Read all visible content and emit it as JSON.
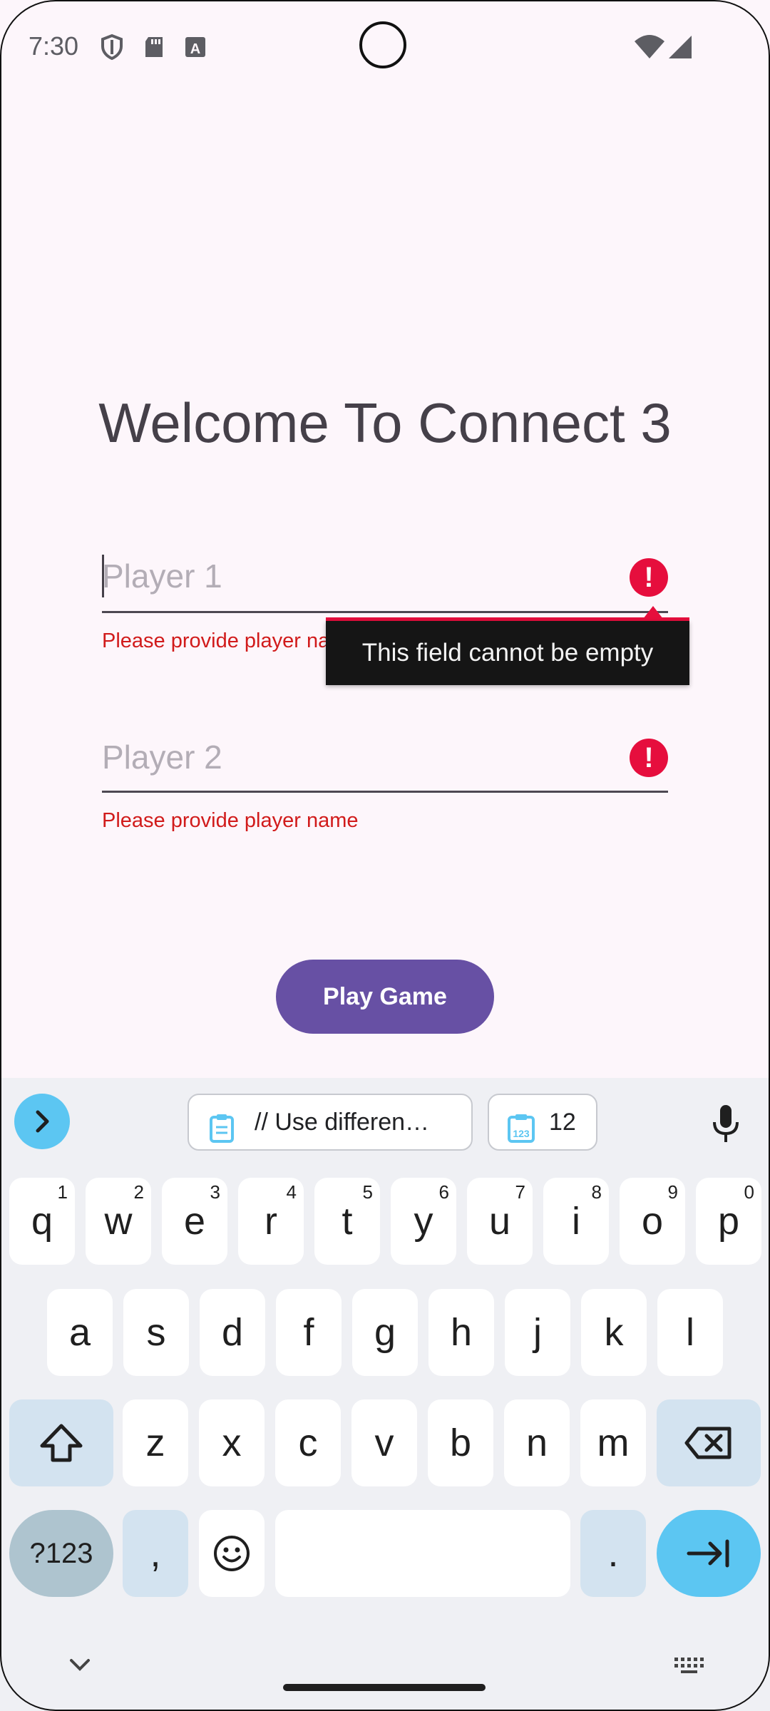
{
  "status_bar": {
    "time": "7:30"
  },
  "app": {
    "title": "Welcome To Connect 3",
    "player1": {
      "placeholder": "Player 1",
      "error": "Please provide player name"
    },
    "player2": {
      "placeholder": "Player 2",
      "error": "Please provide player name"
    },
    "tooltip": "This field cannot be empty",
    "play_button": "Play Game",
    "colors": {
      "accent": "#6750a4",
      "error": "#e60e3d",
      "background": "#fdf6fb"
    }
  },
  "keyboard": {
    "suggestions": {
      "clipboard_text": "// Use differen…",
      "numbers_text": "12"
    },
    "row1": [
      {
        "k": "q",
        "s": "1"
      },
      {
        "k": "w",
        "s": "2"
      },
      {
        "k": "e",
        "s": "3"
      },
      {
        "k": "r",
        "s": "4"
      },
      {
        "k": "t",
        "s": "5"
      },
      {
        "k": "y",
        "s": "6"
      },
      {
        "k": "u",
        "s": "7"
      },
      {
        "k": "i",
        "s": "8"
      },
      {
        "k": "o",
        "s": "9"
      },
      {
        "k": "p",
        "s": "0"
      }
    ],
    "row2": [
      "a",
      "s",
      "d",
      "f",
      "g",
      "h",
      "j",
      "k",
      "l"
    ],
    "row3": [
      "z",
      "x",
      "c",
      "v",
      "b",
      "n",
      "m"
    ],
    "row4": {
      "symbols": "?123",
      "comma": ",",
      "period": "."
    },
    "icons": [
      "chevron-right-icon",
      "clipboard-icon",
      "numbers-clipboard-icon",
      "mic-icon",
      "shift-icon",
      "backspace-icon",
      "emoji-icon",
      "tab-enter-icon",
      "chevron-down-icon",
      "keyboard-icon"
    ]
  }
}
